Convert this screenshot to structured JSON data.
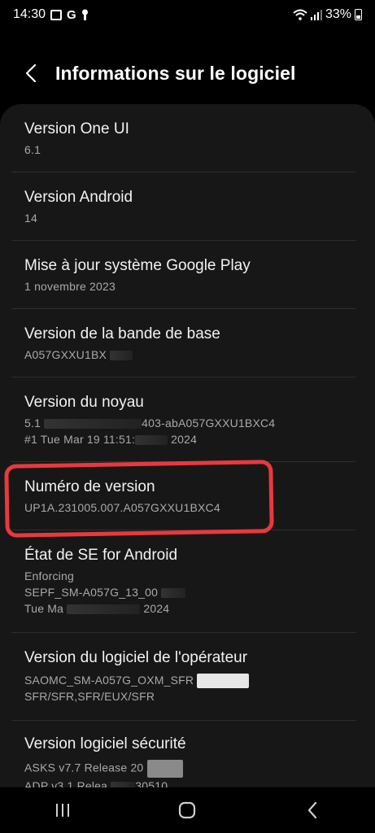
{
  "status_bar": {
    "time": "14:30",
    "icons_left": [
      "gallery-icon",
      "google-icon",
      "keyhole-icon"
    ],
    "google_glyph": "G",
    "battery": "33%",
    "icons_right": [
      "wifi-icon",
      "signal-icon",
      "battery-icon"
    ]
  },
  "header": {
    "title": "Informations sur le logiciel",
    "back_icon": "back-chevron-icon"
  },
  "items": [
    {
      "title": "Version One UI",
      "lines": [
        "6.1"
      ]
    },
    {
      "title": "Version Android",
      "lines": [
        "14"
      ]
    },
    {
      "title": "Mise à jour système Google Play",
      "lines": [
        "1 novembre 2023"
      ]
    },
    {
      "title": "Version de la bande de base",
      "lines": [
        "A057GXXU1BX"
      ]
    },
    {
      "title": "Version du noyau",
      "lines": [
        "5.1",
        "403-abA057GXXU1BXC4",
        "#1 Tue Mar 19 11:51:",
        "2024"
      ]
    },
    {
      "title": "Numéro de version",
      "lines": [
        "UP1A.231005.007.A057GXXU1BXC4"
      ]
    },
    {
      "title": "État de SE for Android",
      "lines": [
        "Enforcing",
        "SEPF_SM-A057G_13_00",
        "Tue Ma",
        "2024"
      ]
    },
    {
      "title": "Version du logiciel de l'opérateur",
      "lines": [
        "SAOMC_SM-A057G_OXM_SFR",
        "SFR/SFR,SFR/EUX/SFR"
      ]
    },
    {
      "title": "Version logiciel sécurité",
      "lines": [
        "ASKS v7.7  Release 20",
        "ADP v3.1  Relea",
        "30510"
      ]
    }
  ],
  "annotation": {
    "color": "#e8393f",
    "target": "Numéro de version"
  },
  "nav": {
    "recents_icon": "recents-icon",
    "home_icon": "home-icon",
    "back_icon": "back-icon"
  }
}
